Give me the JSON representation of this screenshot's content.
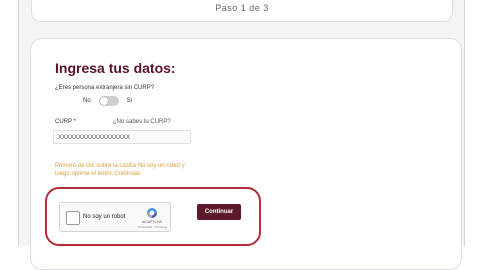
{
  "header": {
    "step_text": "Paso 1 de 3"
  },
  "form": {
    "title": "Ingresa tus datos:",
    "foreign_question": "¿Eres persona extranjera sin CURP?",
    "toggle_no": "No",
    "toggle_yes": "Sí",
    "curp_label": "CURP *",
    "curp_help_link": "¿No sabes tu CURP?",
    "curp_value": "XXXXXXXXXXXXXXXXXX",
    "instruction": "Primero da clic sobre la casilla No soy un robot y luego oprime el botón Continuar."
  },
  "captcha": {
    "label": "No soy un robot",
    "brand": "reCAPTCHA",
    "terms": "Privacidad - Términos"
  },
  "actions": {
    "continue_label": "Continuar"
  },
  "colors": {
    "brand": "#5a1428",
    "highlight": "#b42c3a",
    "instruction": "#d9a23a"
  }
}
